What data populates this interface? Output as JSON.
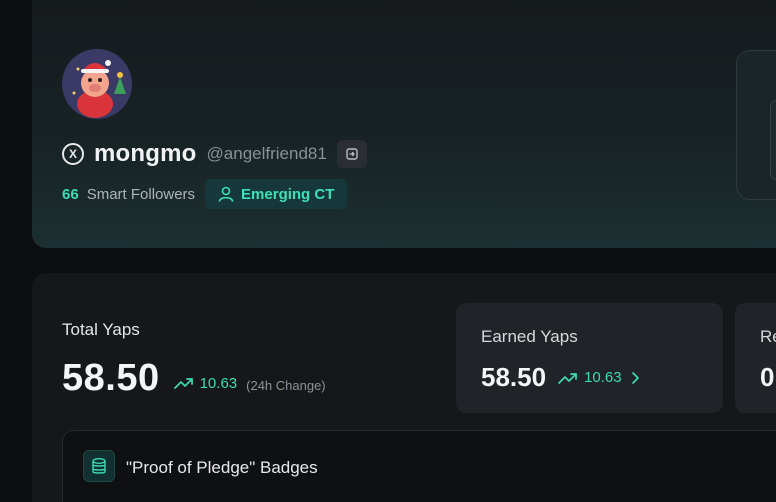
{
  "profile": {
    "display_name": "mongmo",
    "handle": "@angelfriend81",
    "smart_followers_count": "66",
    "smart_followers_label": "Smart Followers",
    "badge_label": "Emerging CT"
  },
  "stats": {
    "total_label": "Total Yaps",
    "total_value": "58.50",
    "total_change": "10.63",
    "total_change_note": "(24h Change)",
    "earned_label": "Earned Yaps",
    "earned_value": "58.50",
    "earned_change": "10.63",
    "next_label_partial": "Re",
    "next_value_partial": "0"
  },
  "badges": {
    "title": "\"Proof of Pledge\" Badges"
  },
  "colors": {
    "accent": "#3ddbb2",
    "background": "#0d0e10",
    "card": "#15171a"
  },
  "icons": [
    "x-logo-icon",
    "copy-icon",
    "user-icon",
    "trend-up-icon",
    "chevron-right-icon",
    "coins-stack-icon"
  ]
}
